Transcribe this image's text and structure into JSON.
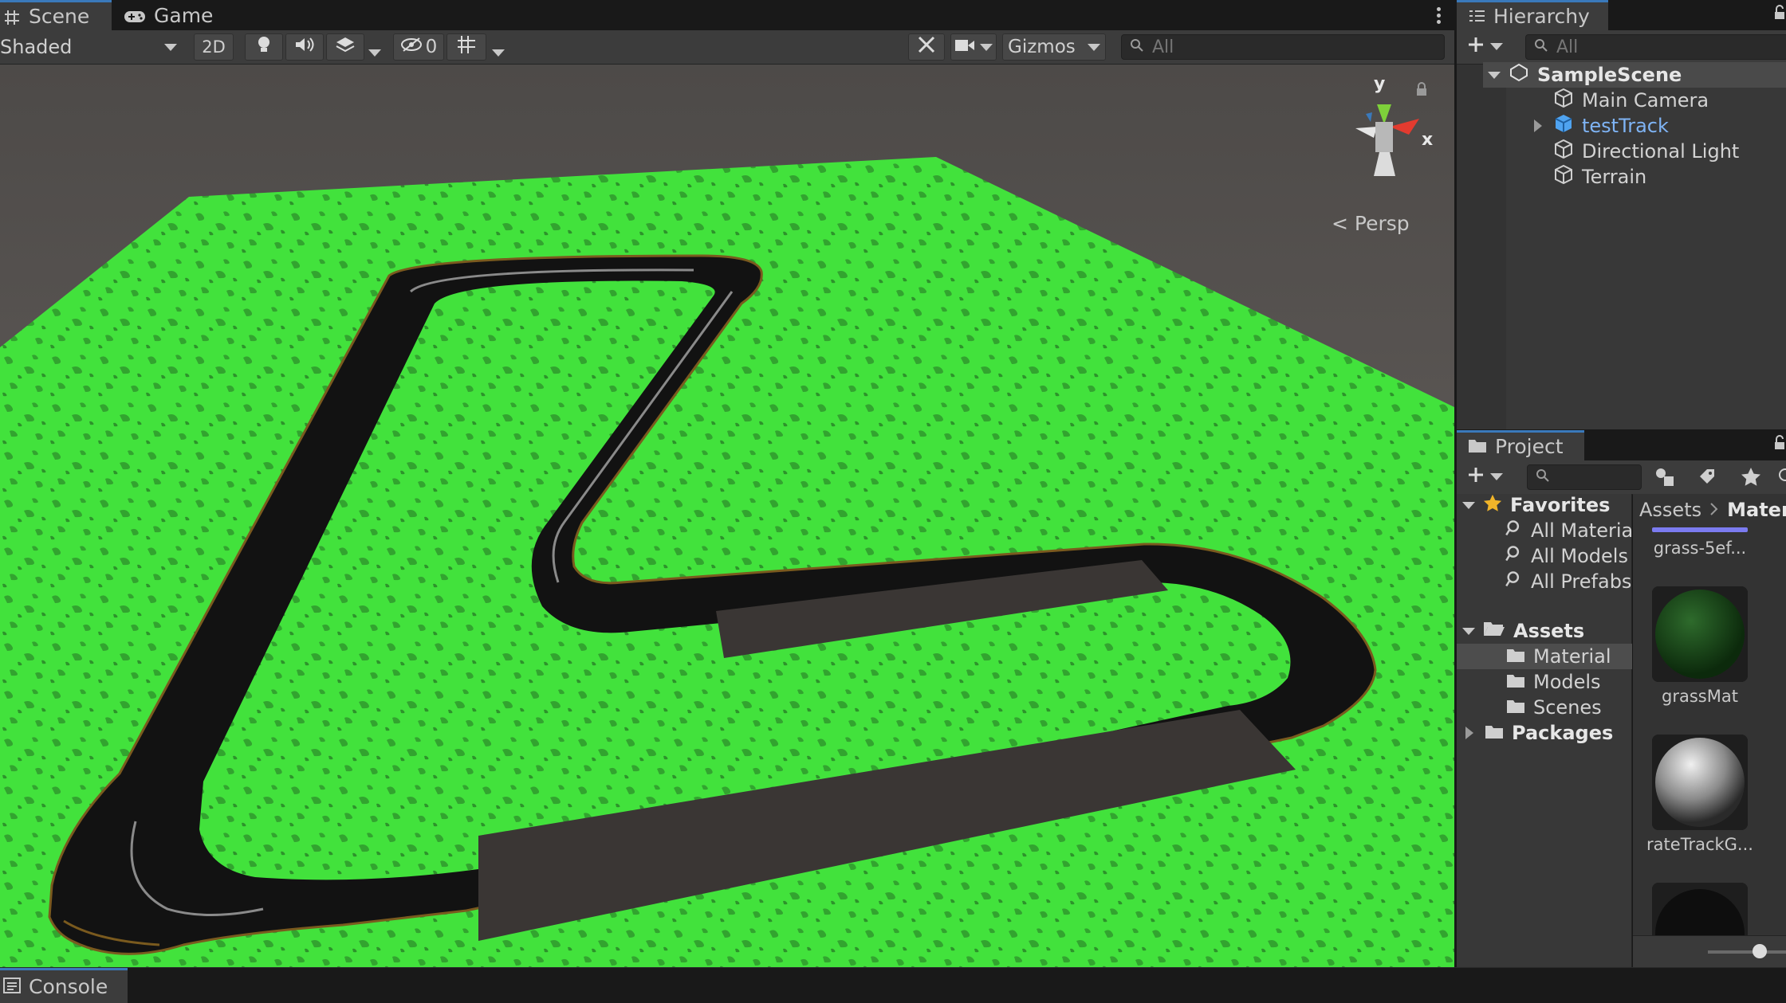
{
  "scene_tabs": [
    {
      "label": "Scene",
      "icon": "grid-icon"
    },
    {
      "label": "Game",
      "icon": "gamepad-icon"
    }
  ],
  "toolbar": {
    "draw_mode": "Shaded",
    "mode_2d": "2D",
    "hidden_count": "0",
    "gizmos": "Gizmos",
    "search_placeholder": "All"
  },
  "viewport": {
    "projection": "Persp",
    "axis_y": "y",
    "axis_x": "x"
  },
  "hierarchy": {
    "tab_label": "Hierarchy",
    "search_placeholder": "All",
    "scene_name": "SampleScene",
    "items": [
      {
        "label": "Main Camera",
        "color": "#d2d2d2"
      },
      {
        "label": "testTrack",
        "color": "#7fb4f5"
      },
      {
        "label": "Directional Light",
        "color": "#d2d2d2"
      },
      {
        "label": "Terrain",
        "color": "#d2d2d2"
      }
    ]
  },
  "project": {
    "tab_label": "Project",
    "favorites_label": "Favorites",
    "favorites": [
      "All Materia",
      "All Models",
      "All Prefabs"
    ],
    "assets_label": "Assets",
    "asset_folders": [
      "Material",
      "Models",
      "Scenes"
    ],
    "packages_label": "Packages",
    "breadcrumb": [
      "Assets",
      "Materi"
    ],
    "assets": [
      {
        "label": "grass-5ef..."
      },
      {
        "label": "grassMat"
      },
      {
        "label": "rateTrackG..."
      }
    ]
  },
  "console": {
    "label": "Console"
  },
  "colors": {
    "accent": "#3a79bb",
    "grass": "#3ee83a",
    "track": "#141414",
    "selected_object": "#7fb4f5"
  }
}
